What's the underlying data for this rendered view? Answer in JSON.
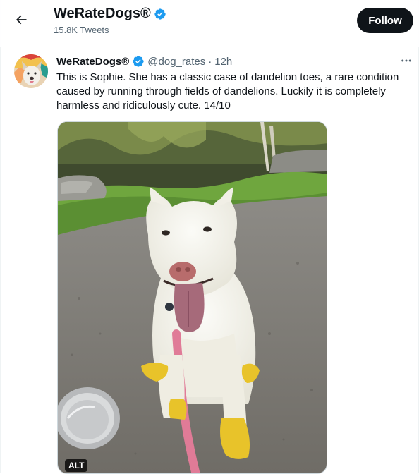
{
  "header": {
    "back_icon": "arrow-left-icon",
    "title": "WeRateDogs®",
    "tweet_count": "15.8K Tweets",
    "follow_label": "Follow",
    "verified_icon": "verified-badge-icon"
  },
  "tweet": {
    "display_name": "WeRateDogs®",
    "handle": "@dog_rates",
    "separator": "·",
    "time": "12h",
    "more_icon": "more-horizontal-icon",
    "text": "This is Sophie. She has a classic case of dandelion toes, a rare condition caused by running through fields of dandelions. Luckily it is completely harmless and ridiculously cute. 14/10",
    "media": {
      "alt_label": "ALT"
    }
  },
  "colors": {
    "verified_blue": "#1d9bf0",
    "follow_bg": "#0f1419",
    "secondary_text": "#536471"
  }
}
